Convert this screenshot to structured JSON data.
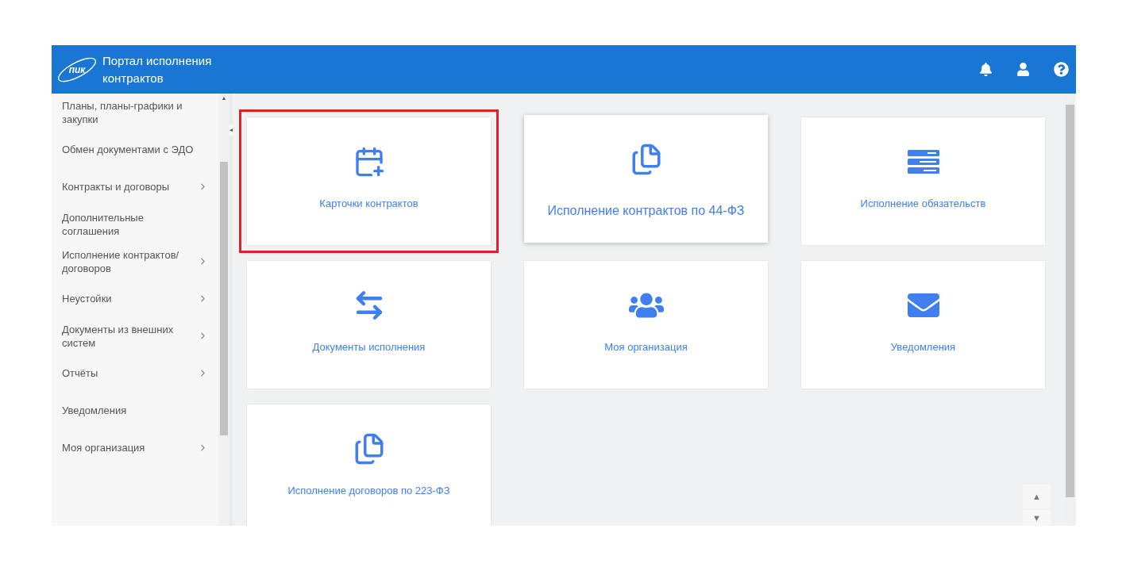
{
  "header": {
    "logo_text": "пик",
    "title": "Портал исполнения контрактов"
  },
  "sidebar": {
    "scroll_up": "▲",
    "collapse_handle": "◀",
    "items": [
      {
        "label": "Планы, планы-графики и закупки",
        "has_submenu": false
      },
      {
        "label": "Обмен документами с ЭДО",
        "has_submenu": false
      },
      {
        "label": "Контракты и договоры",
        "has_submenu": true
      },
      {
        "label": "Дополнительные соглашения",
        "has_submenu": false
      },
      {
        "label": "Исполнение контрактов/ договоров",
        "has_submenu": true
      },
      {
        "label": "Неустойки",
        "has_submenu": true
      },
      {
        "label": "Документы из внешних систем",
        "has_submenu": true
      },
      {
        "label": "Отчёты",
        "has_submenu": true
      },
      {
        "label": "Уведомления",
        "has_submenu": false
      },
      {
        "label": "Моя организация",
        "has_submenu": true
      }
    ]
  },
  "tiles": [
    {
      "kind": "calendar",
      "label": "Карточки контрактов",
      "highlighted": true,
      "hovered": false
    },
    {
      "kind": "files",
      "label": "Исполнение контрактов по 44-ФЗ",
      "highlighted": false,
      "hovered": true
    },
    {
      "kind": "server",
      "label": "Исполнение обязательств",
      "highlighted": false,
      "hovered": false
    },
    {
      "kind": "exchange",
      "label": "Документы исполнения",
      "highlighted": false,
      "hovered": false
    },
    {
      "kind": "users",
      "label": "Моя организация",
      "highlighted": false,
      "hovered": false
    },
    {
      "kind": "mail",
      "label": "Уведомления",
      "highlighted": false,
      "hovered": false
    },
    {
      "kind": "files",
      "label": "Исполнение договоров по 223-ФЗ",
      "highlighted": false,
      "hovered": false
    }
  ],
  "page_scroll": {
    "up": "▲",
    "down": "▼"
  }
}
